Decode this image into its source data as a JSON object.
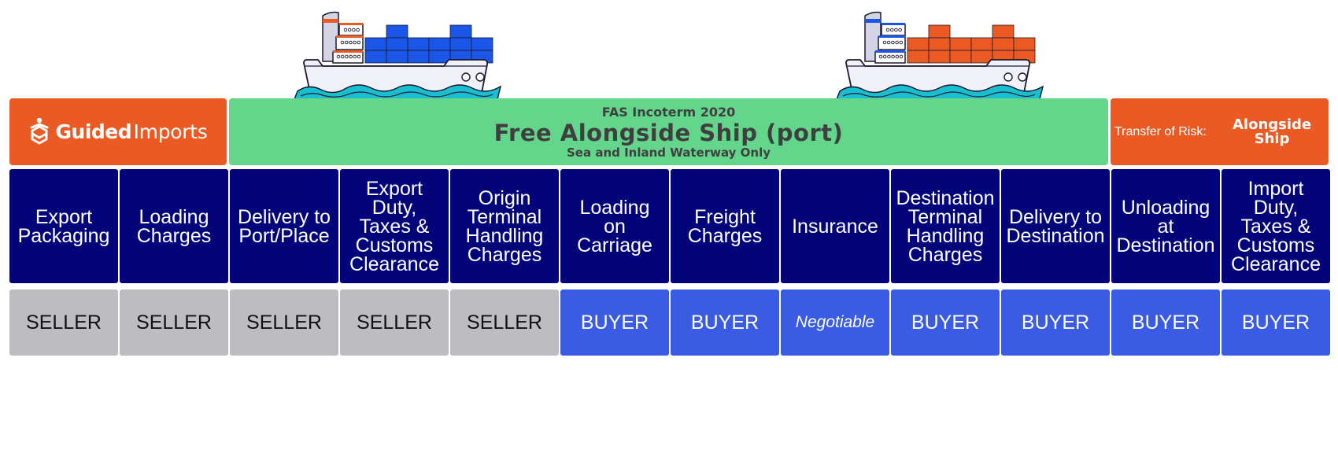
{
  "colors": {
    "orange": "#EC5A24",
    "green": "#64D68B",
    "navy": "#03037A",
    "seller_gray": "#BCBCC1",
    "buyer_blue": "#3A5CE5",
    "water": "#19BFD0",
    "container_blue": "#1A56E8",
    "container_orange": "#EC5A24"
  },
  "brand": {
    "icon": "guided-imports-logo-icon",
    "name_bold": "Guided",
    "name_light": "Imports"
  },
  "title": {
    "superscript": "FAS Incoterm 2020",
    "main": "Free Alongside Ship (port)",
    "subtitle": "Sea and Inland Waterway Only"
  },
  "risk": {
    "label": "Transfer of Risk:",
    "value_line1": "Alongside",
    "value_line2": "Ship"
  },
  "ships": [
    {
      "name": "origin-ship",
      "container_color": "blue",
      "stripe_color": "orange"
    },
    {
      "name": "destination-ship",
      "container_color": "orange",
      "stripe_color": "blue"
    }
  ],
  "columns": [
    {
      "category": [
        "Export",
        "Packaging"
      ],
      "responsibility": "SELLER",
      "party": "seller"
    },
    {
      "category": [
        "Loading",
        "Charges"
      ],
      "responsibility": "SELLER",
      "party": "seller"
    },
    {
      "category": [
        "Delivery to",
        "Port/Place"
      ],
      "responsibility": "SELLER",
      "party": "seller"
    },
    {
      "category": [
        "Export",
        "Duty,",
        "Taxes &",
        "Customs",
        "Clearance"
      ],
      "responsibility": "SELLER",
      "party": "seller"
    },
    {
      "category": [
        "Origin",
        "Terminal",
        "Handling",
        "Charges"
      ],
      "responsibility": "SELLER",
      "party": "seller"
    },
    {
      "category": [
        "Loading",
        "on",
        "Carriage"
      ],
      "responsibility": "BUYER",
      "party": "buyer"
    },
    {
      "category": [
        "Freight",
        "Charges"
      ],
      "responsibility": "BUYER",
      "party": "buyer"
    },
    {
      "category": [
        "Insurance"
      ],
      "responsibility": "Negotiable",
      "party": "negotiable"
    },
    {
      "category": [
        "Destination",
        "Terminal",
        "Handling",
        "Charges"
      ],
      "responsibility": "BUYER",
      "party": "buyer"
    },
    {
      "category": [
        "Delivery to",
        "Destination"
      ],
      "responsibility": "BUYER",
      "party": "buyer"
    },
    {
      "category": [
        "Unloading",
        "at",
        "Destination"
      ],
      "responsibility": "BUYER",
      "party": "buyer"
    },
    {
      "category": [
        "Import",
        "Duty,",
        "Taxes &",
        "Customs",
        "Clearance"
      ],
      "responsibility": "BUYER",
      "party": "buyer"
    }
  ]
}
